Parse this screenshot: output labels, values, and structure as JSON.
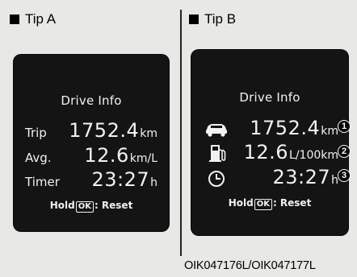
{
  "tip_a": {
    "label": "Tip A",
    "screen": {
      "title": "Drive Info",
      "rows": [
        {
          "label": "Trip",
          "value": "1752.4",
          "unit": "km"
        },
        {
          "label": "Avg.",
          "value": "12.6",
          "unit": "km/L"
        },
        {
          "label": "Timer",
          "value": "23:27",
          "unit": "h"
        }
      ],
      "hold_prefix": "Hold",
      "hold_button": "OK",
      "hold_suffix": ": Reset"
    }
  },
  "tip_b": {
    "label": "Tip B",
    "screen": {
      "title": "Drive Info",
      "rows": [
        {
          "icon": "car-icon",
          "value": "1752.4",
          "unit": "km",
          "marker": "1"
        },
        {
          "icon": "fuel-pump-icon",
          "value": "12.6",
          "unit": "L/100km",
          "marker": "2"
        },
        {
          "icon": "clock-icon",
          "value": "23:27",
          "unit": "h",
          "marker": "3"
        }
      ],
      "hold_prefix": "Hold",
      "hold_button": "OK",
      "hold_suffix": ": Reset"
    }
  },
  "caption": "OIK047176L/OIK047177L",
  "colors": {
    "background": "#e8e8e6",
    "screen": "#141414",
    "screen_text": "#f2f2f2"
  }
}
